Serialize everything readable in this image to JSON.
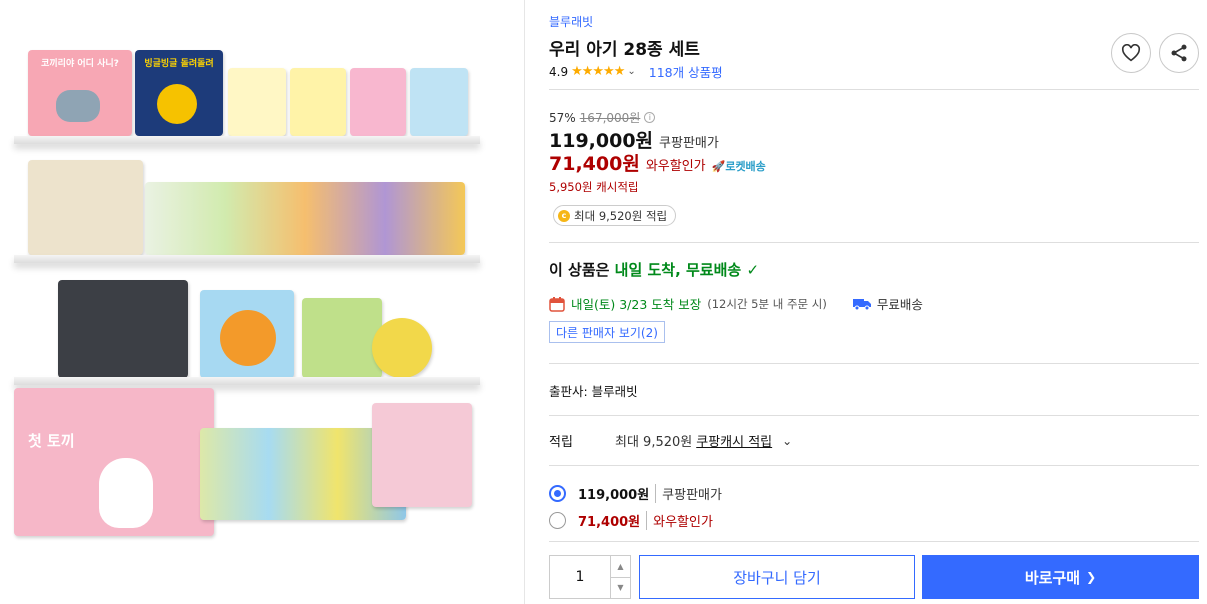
{
  "product_image": {
    "book_titles": {
      "b1": "코끼리야 어디 사니?",
      "b2": "빙글빙글 돌려돌려",
      "b3": "첫 토끼"
    }
  },
  "brand": "블루래빗",
  "title": "우리 아기 28종 세트",
  "rating": {
    "score": "4.9",
    "stars": "★★★★★",
    "review_count": "118개 상품평"
  },
  "price": {
    "discount_rate": "57%",
    "original": "167,000원",
    "main": "119,000원",
    "main_label": "쿠팡판매가",
    "wow": "71,400원",
    "wow_label": "와우할인가",
    "rocket": "🚀로켓배송",
    "cash_reward": "5,950원 캐시적립",
    "max_reward": "최대 9,520원 적립"
  },
  "delivery": {
    "prefix": "이 상품은 ",
    "highlight": "내일 도착, 무료배송",
    "check": "✓",
    "date": "내일(토) 3/23 도착 보장",
    "cutoff": "(12시간 5분 내 주문 시)",
    "free": "무료배송",
    "other_sellers": "다른 판매자 보기(2)"
  },
  "publisher": "출판사: 블루래빗",
  "reward": {
    "label": "적립",
    "text": "최대 9,520원",
    "link": "쿠팡캐시 적립"
  },
  "options": [
    {
      "price": "119,000원",
      "label": "쿠팡판매가",
      "selected": true
    },
    {
      "price": "71,400원",
      "label": "와우할인가",
      "selected": false
    }
  ],
  "quantity": "1",
  "buttons": {
    "cart": "장바구니 담기",
    "buy": "바로구매",
    "buy_arrow": "❯"
  },
  "colors": {
    "accent": "#346aff",
    "wow_red": "#ae0000",
    "green": "#00891a",
    "star": "#fdab00"
  }
}
